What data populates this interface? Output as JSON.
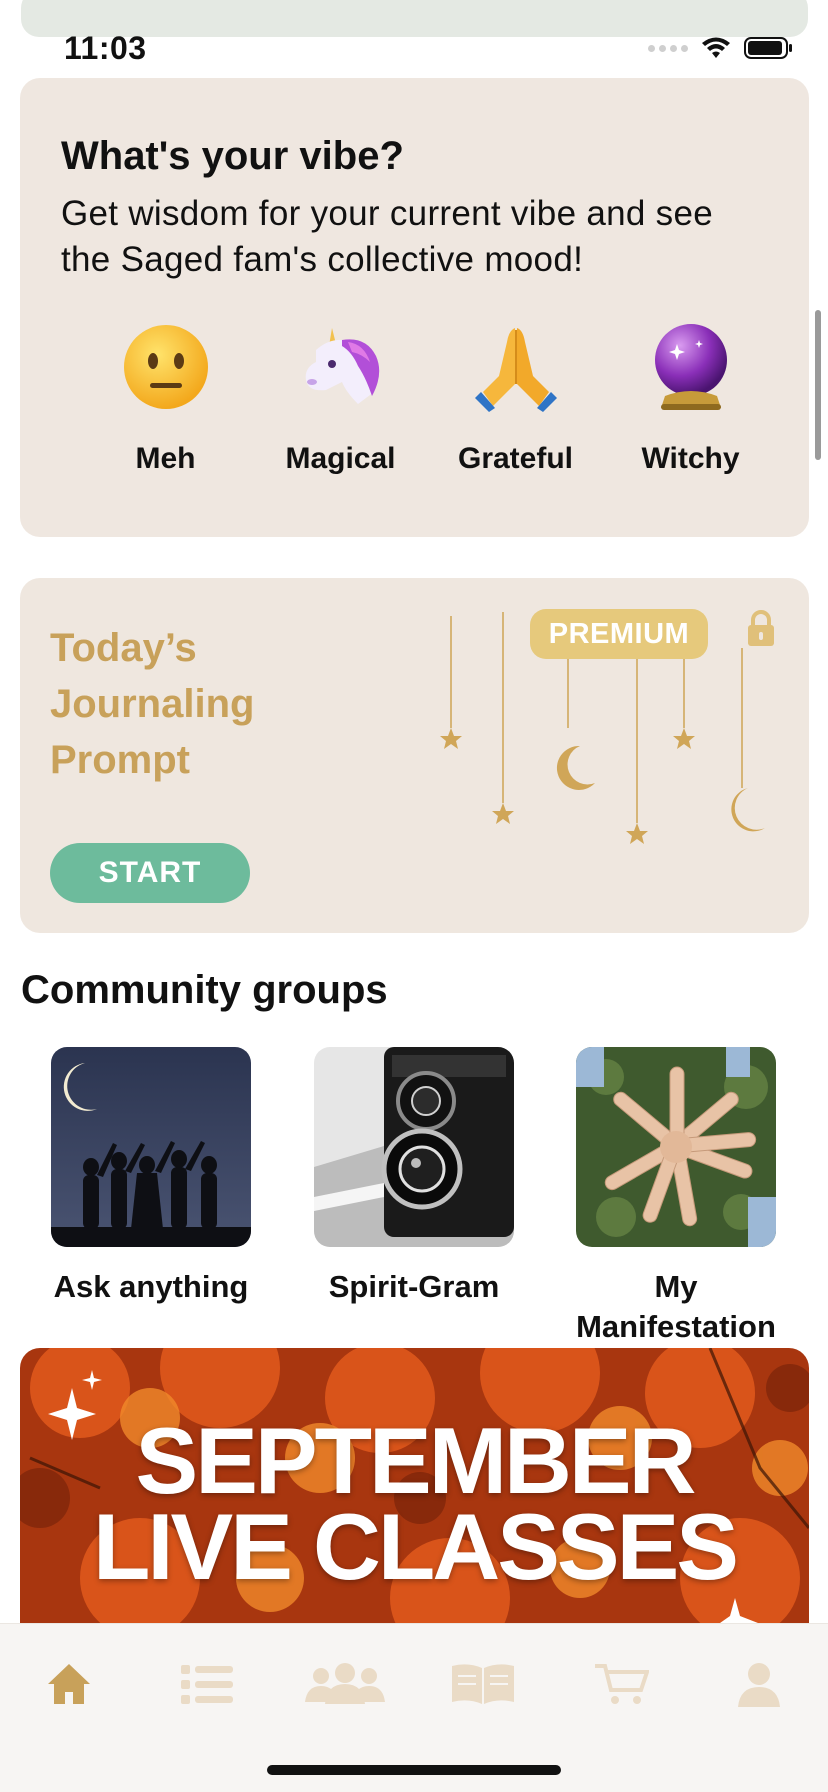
{
  "status_bar": {
    "time": "11:03"
  },
  "vibe": {
    "title": "What's your vibe?",
    "description": "Get wisdom for your current vibe and see the Saged fam's collective mood!",
    "options": [
      {
        "label": "Meh",
        "icon": "neutral-face-icon"
      },
      {
        "label": "Magical",
        "icon": "unicorn-icon"
      },
      {
        "label": "Grateful",
        "icon": "folded-hands-icon"
      },
      {
        "label": "Witchy",
        "icon": "crystal-ball-icon"
      }
    ]
  },
  "prompt": {
    "title": "Today’s Journaling Prompt",
    "start_label": "START",
    "badge": "PREMIUM",
    "accent": "#c8a15a",
    "button_color": "#6dbb9c"
  },
  "community": {
    "title": "Community groups",
    "groups": [
      {
        "label": "Ask anything",
        "image": "moon-silhouettes-image"
      },
      {
        "label": "Spirit-Gram",
        "image": "vintage-camera-image"
      },
      {
        "label": "My Manifestation",
        "image": "joined-hands-image"
      }
    ]
  },
  "banner": {
    "line1": "SEPTEMBER",
    "line2": "LIVE CLASSES"
  },
  "tabbar": {
    "active_color": "#c8a15a",
    "inactive_color": "#eadbc6",
    "tabs": [
      "home-icon",
      "list-icon",
      "community-icon",
      "book-icon",
      "cart-icon",
      "profile-icon"
    ]
  }
}
